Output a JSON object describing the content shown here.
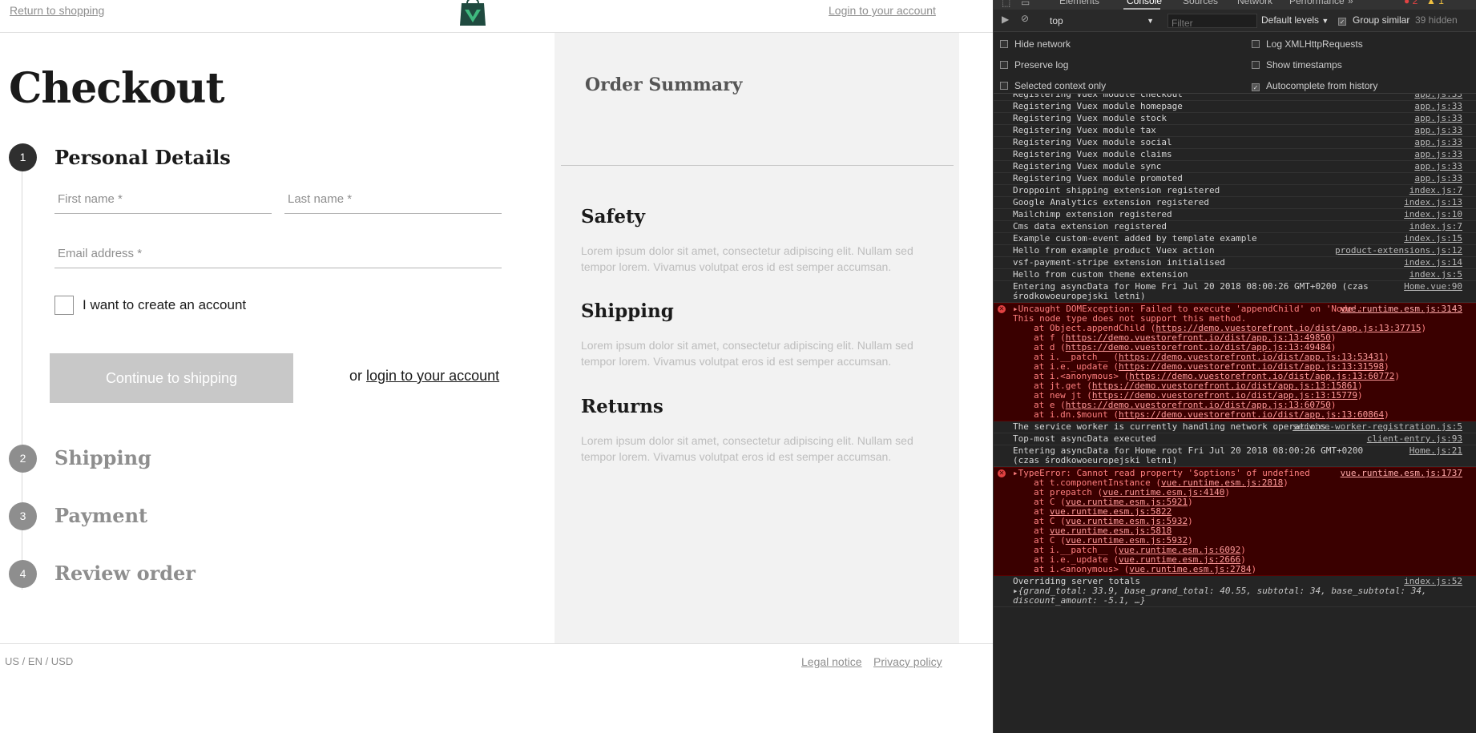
{
  "header": {
    "return_link": "Return to shopping",
    "login_link": "Login to your account",
    "logo": "bag-logo"
  },
  "checkout": {
    "title": "Checkout",
    "steps": [
      {
        "number": "1",
        "title": "Personal Details",
        "active": true
      },
      {
        "number": "2",
        "title": "Shipping",
        "active": false
      },
      {
        "number": "3",
        "title": "Payment",
        "active": false
      },
      {
        "number": "4",
        "title": "Review order",
        "active": false
      }
    ],
    "fields": {
      "first_name": {
        "placeholder": "First name *",
        "value": ""
      },
      "last_name": {
        "placeholder": "Last name *",
        "value": ""
      },
      "email": {
        "placeholder": "Email address *",
        "value": ""
      }
    },
    "create_account_label": "I want to create an account",
    "create_account_checked": false,
    "continue_label": "Continue to shipping",
    "or_text": "or",
    "or_login_link": "login to your account"
  },
  "summary": {
    "title": "Order Summary",
    "sections": [
      {
        "heading": "Safety",
        "text": "Lorem ipsum dolor sit amet, consectetur adipiscing elit. Nullam sed tempor lorem. Vivamus volutpat eros id est semper accumsan."
      },
      {
        "heading": "Shipping",
        "text": "Lorem ipsum dolor sit amet, consectetur adipiscing elit. Nullam sed tempor lorem. Vivamus volutpat eros id est semper accumsan."
      },
      {
        "heading": "Returns",
        "text": "Lorem ipsum dolor sit amet, consectetur adipiscing elit. Nullam sed tempor lorem. Vivamus volutpat eros id est semper accumsan."
      }
    ]
  },
  "footer": {
    "locale": "US / EN / USD",
    "legal_link": "Legal notice",
    "privacy_link": "Privacy policy"
  },
  "devtools": {
    "tabs": [
      "Elements",
      "Console",
      "Sources",
      "Network",
      "Performance"
    ],
    "active_tab": "Console",
    "more_tabs": "»",
    "error_count": "2",
    "warning_count": "1",
    "context": "top",
    "filter_placeholder": "Filter",
    "levels": "Default levels",
    "group_similar": "Group similar",
    "group_similar_checked": true,
    "hidden_count": "39 hidden",
    "settings": {
      "hide_network": "Hide network",
      "preserve_log": "Preserve log",
      "selected_context": "Selected context only",
      "log_xhr": "Log XMLHttpRequests",
      "show_timestamps": "Show timestamps",
      "autocomplete": "Autocomplete from history",
      "autocomplete_checked": true
    },
    "colors": {
      "error_bg": "#3a0000",
      "error_text": "#ff7f7f",
      "panel_bg": "#242424"
    },
    "logs": [
      {
        "type": "log",
        "msg": "Registering Vuex module checkout",
        "src": "app.js:33"
      },
      {
        "type": "log",
        "msg": "Registering Vuex module homepage",
        "src": "app.js:33"
      },
      {
        "type": "log",
        "msg": "Registering Vuex module stock",
        "src": "app.js:33"
      },
      {
        "type": "log",
        "msg": "Registering Vuex module tax",
        "src": "app.js:33"
      },
      {
        "type": "log",
        "msg": "Registering Vuex module social",
        "src": "app.js:33"
      },
      {
        "type": "log",
        "msg": "Registering Vuex module claims",
        "src": "app.js:33"
      },
      {
        "type": "log",
        "msg": "Registering Vuex module sync",
        "src": "app.js:33"
      },
      {
        "type": "log",
        "msg": "Registering Vuex module promoted",
        "src": "app.js:33"
      },
      {
        "type": "log",
        "msg": "Droppoint shipping extension registered",
        "src": "index.js:7"
      },
      {
        "type": "log",
        "msg": "Google Analytics extension registered",
        "src": "index.js:13"
      },
      {
        "type": "log",
        "msg": "Mailchimp extension registered",
        "src": "index.js:10"
      },
      {
        "type": "log",
        "msg": "Cms data extension registered",
        "src": "index.js:7"
      },
      {
        "type": "log",
        "msg": "Example custom-event added by template example",
        "src": "index.js:15"
      },
      {
        "type": "log",
        "msg": "Hello from example product Vuex action",
        "src": "product-extensions.js:12"
      },
      {
        "type": "log",
        "msg": "vsf-payment-stripe extension initialised",
        "src": "index.js:14"
      },
      {
        "type": "log",
        "msg": "Hello from custom theme extension",
        "src": "index.js:5"
      },
      {
        "type": "log",
        "msg": "Entering asyncData for Home Fri Jul 20 2018 08:00:26 GMT+0200 (czas środkowoeuropejski letni)",
        "src": "Home.vue:90"
      },
      {
        "type": "error",
        "msg": "▸Uncaught DOMException: Failed to execute 'appendChild' on 'Node': This node type does not support this method.",
        "src": "vue.runtime.esm.js:3143",
        "stack": [
          {
            "pre": "at Object.appendChild (",
            "link": "https://demo.vuestorefront.io/dist/app.js:13:37715",
            "post": ")"
          },
          {
            "pre": "at f (",
            "link": "https://demo.vuestorefront.io/dist/app.js:13:49850",
            "post": ")"
          },
          {
            "pre": "at d (",
            "link": "https://demo.vuestorefront.io/dist/app.js:13:49484",
            "post": ")"
          },
          {
            "pre": "at i.__patch__ (",
            "link": "https://demo.vuestorefront.io/dist/app.js:13:53431",
            "post": ")"
          },
          {
            "pre": "at i.e._update (",
            "link": "https://demo.vuestorefront.io/dist/app.js:13:31598",
            "post": ")"
          },
          {
            "pre": "at i.<anonymous> (",
            "link": "https://demo.vuestorefront.io/dist/app.js:13:60772",
            "post": ")"
          },
          {
            "pre": "at jt.get (",
            "link": "https://demo.vuestorefront.io/dist/app.js:13:15861",
            "post": ")"
          },
          {
            "pre": "at new jt (",
            "link": "https://demo.vuestorefront.io/dist/app.js:13:15779",
            "post": ")"
          },
          {
            "pre": "at e (",
            "link": "https://demo.vuestorefront.io/dist/app.js:13:60750",
            "post": ")"
          },
          {
            "pre": "at i.dn.$mount (",
            "link": "https://demo.vuestorefront.io/dist/app.js:13:60864",
            "post": ")"
          }
        ]
      },
      {
        "type": "log",
        "msg": "The service worker is currently handling network operations.",
        "src": "service-worker-registration.js:5"
      },
      {
        "type": "log",
        "msg": "Top-most asyncData executed",
        "src": "client-entry.js:93"
      },
      {
        "type": "log",
        "msg": "Entering asyncData for Home root Fri Jul 20 2018 08:00:26 GMT+0200 (czas środkowoeuropejski letni)",
        "src": "Home.js:21"
      },
      {
        "type": "error",
        "msg": "▸TypeError: Cannot read property '$options' of undefined",
        "src": "vue.runtime.esm.js:1737",
        "stack": [
          {
            "pre": "at t.componentInstance (",
            "link": "vue.runtime.esm.js:2818",
            "post": ")"
          },
          {
            "pre": "at prepatch (",
            "link": "vue.runtime.esm.js:4140",
            "post": ")"
          },
          {
            "pre": "at C (",
            "link": "vue.runtime.esm.js:5921",
            "post": ")"
          },
          {
            "pre": "at ",
            "link": "vue.runtime.esm.js:5822",
            "post": ""
          },
          {
            "pre": "at C (",
            "link": "vue.runtime.esm.js:5932",
            "post": ")"
          },
          {
            "pre": "at ",
            "link": "vue.runtime.esm.js:5818",
            "post": ""
          },
          {
            "pre": "at C (",
            "link": "vue.runtime.esm.js:5932",
            "post": ")"
          },
          {
            "pre": "at i.__patch__ (",
            "link": "vue.runtime.esm.js:6092",
            "post": ")"
          },
          {
            "pre": "at i.e._update (",
            "link": "vue.runtime.esm.js:2666",
            "post": ")"
          },
          {
            "pre": "at i.<anonymous> (",
            "link": "vue.runtime.esm.js:2784",
            "post": ")"
          }
        ]
      },
      {
        "type": "log",
        "msg": "Overriding server totals",
        "src": "index.js:52",
        "obj": "▸{grand_total: 33.9, base_grand_total: 40.55, subtotal: 34, base_subtotal: 34, discount_amount: -5.1, …}"
      }
    ]
  }
}
